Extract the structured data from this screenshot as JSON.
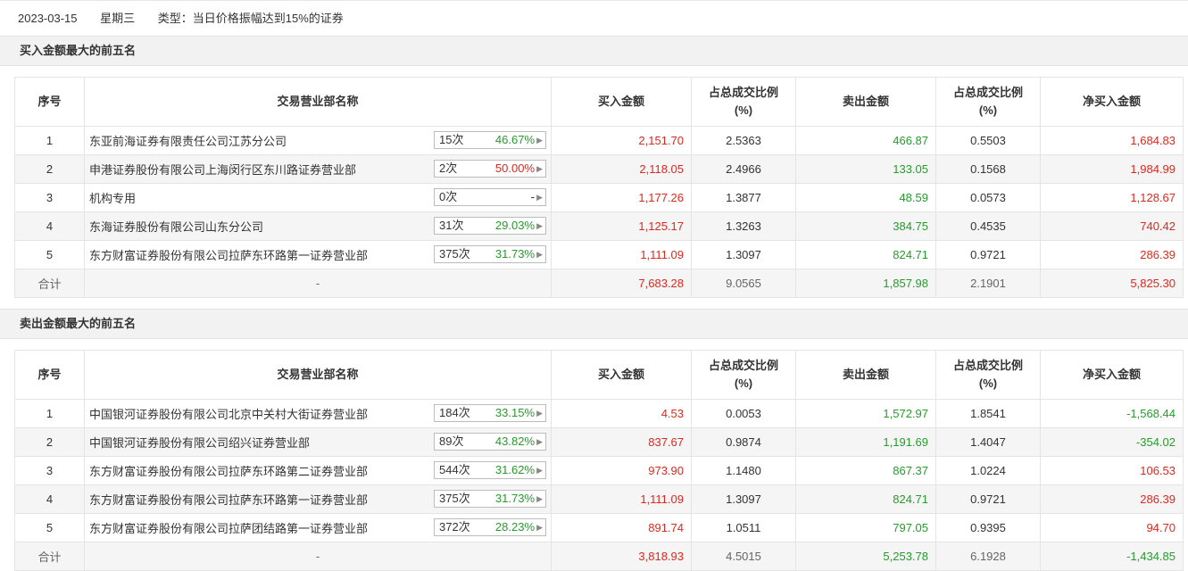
{
  "header": {
    "date": "2023-03-15",
    "weekday": "星期三",
    "type": "类型：当日价格振幅达到15%的证券"
  },
  "columns": [
    "序号",
    "交易营业部名称",
    "买入金额",
    "占总成交比例\n(%)",
    "卖出金额",
    "占总成交比例\n(%)",
    "净买入金额"
  ],
  "buy_section": {
    "title": "买入金额最大的前五名",
    "rows": [
      {
        "idx": "1",
        "name": "东亚前海证券有限责任公司江苏分公司",
        "count": "15次",
        "pct": "46.67%",
        "pct_color": "green",
        "buy": "2,151.70",
        "buy_ratio": "2.5363",
        "sell": "466.87",
        "sell_ratio": "0.5503",
        "net": "1,684.83",
        "net_color": "red"
      },
      {
        "idx": "2",
        "name": "申港证券股份有限公司上海闵行区东川路证券营业部",
        "count": "2次",
        "pct": "50.00%",
        "pct_color": "red",
        "buy": "2,118.05",
        "buy_ratio": "2.4966",
        "sell": "133.05",
        "sell_ratio": "0.1568",
        "net": "1,984.99",
        "net_color": "red"
      },
      {
        "idx": "3",
        "name": "机构专用",
        "count": "0次",
        "pct": "-",
        "pct_color": "gray",
        "buy": "1,177.26",
        "buy_ratio": "1.3877",
        "sell": "48.59",
        "sell_ratio": "0.0573",
        "net": "1,128.67",
        "net_color": "red"
      },
      {
        "idx": "4",
        "name": "东海证券股份有限公司山东分公司",
        "count": "31次",
        "pct": "29.03%",
        "pct_color": "green",
        "buy": "1,125.17",
        "buy_ratio": "1.3263",
        "sell": "384.75",
        "sell_ratio": "0.4535",
        "net": "740.42",
        "net_color": "red"
      },
      {
        "idx": "5",
        "name": "东方财富证券股份有限公司拉萨东环路第一证券营业部",
        "count": "375次",
        "pct": "31.73%",
        "pct_color": "green",
        "buy": "1,111.09",
        "buy_ratio": "1.3097",
        "sell": "824.71",
        "sell_ratio": "0.9721",
        "net": "286.39",
        "net_color": "red"
      }
    ],
    "total": {
      "label": "合计",
      "name": "-",
      "buy": "7,683.28",
      "buy_ratio": "9.0565",
      "sell": "1,857.98",
      "sell_ratio": "2.1901",
      "net": "5,825.30",
      "net_color": "red"
    }
  },
  "sell_section": {
    "title": "卖出金额最大的前五名",
    "rows": [
      {
        "idx": "1",
        "name": "中国银河证券股份有限公司北京中关村大街证券营业部",
        "count": "184次",
        "pct": "33.15%",
        "pct_color": "green",
        "buy": "4.53",
        "buy_ratio": "0.0053",
        "sell": "1,572.97",
        "sell_ratio": "1.8541",
        "net": "-1,568.44",
        "net_color": "green"
      },
      {
        "idx": "2",
        "name": "中国银河证券股份有限公司绍兴证券营业部",
        "count": "89次",
        "pct": "43.82%",
        "pct_color": "green",
        "buy": "837.67",
        "buy_ratio": "0.9874",
        "sell": "1,191.69",
        "sell_ratio": "1.4047",
        "net": "-354.02",
        "net_color": "green"
      },
      {
        "idx": "3",
        "name": "东方财富证券股份有限公司拉萨东环路第二证券营业部",
        "count": "544次",
        "pct": "31.62%",
        "pct_color": "green",
        "buy": "973.90",
        "buy_ratio": "1.1480",
        "sell": "867.37",
        "sell_ratio": "1.0224",
        "net": "106.53",
        "net_color": "red"
      },
      {
        "idx": "4",
        "name": "东方财富证券股份有限公司拉萨东环路第一证券营业部",
        "count": "375次",
        "pct": "31.73%",
        "pct_color": "green",
        "buy": "1,111.09",
        "buy_ratio": "1.3097",
        "sell": "824.71",
        "sell_ratio": "0.9721",
        "net": "286.39",
        "net_color": "red"
      },
      {
        "idx": "5",
        "name": "东方财富证券股份有限公司拉萨团结路第一证券营业部",
        "count": "372次",
        "pct": "28.23%",
        "pct_color": "green",
        "buy": "891.74",
        "buy_ratio": "1.0511",
        "sell": "797.05",
        "sell_ratio": "0.9395",
        "net": "94.70",
        "net_color": "red"
      }
    ],
    "total": {
      "label": "合计",
      "name": "-",
      "buy": "3,818.93",
      "buy_ratio": "4.5015",
      "sell": "5,253.78",
      "sell_ratio": "6.1928",
      "net": "-1,434.85",
      "net_color": "green"
    }
  },
  "colors": {
    "red": "#e0281e",
    "green": "#259c2b",
    "gray": "#333333"
  }
}
